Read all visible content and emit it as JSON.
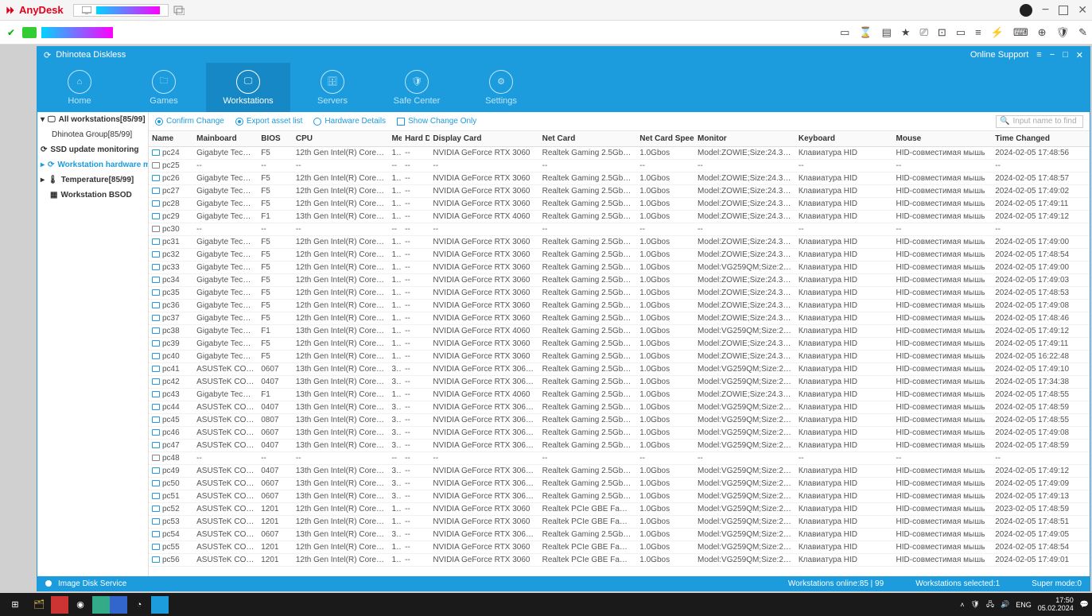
{
  "anydesk": {
    "name": "AnyDesk"
  },
  "app": {
    "title": "Dhinotea Diskless",
    "online_support": "Online Support",
    "nav": [
      "Home",
      "Games",
      "Workstations",
      "Servers",
      "Safe Center",
      "Settings"
    ],
    "nav_active": 2
  },
  "sidebar": {
    "all": "All workstations[85/99]",
    "group": "Dhinotea Group[85/99]",
    "ssd": "SSD update monitoring",
    "hwmon": "Workstation hardware mon",
    "temp": "Temperature[85/99]",
    "bsod": "Workstation BSOD"
  },
  "toolbar": {
    "confirm": "Confirm Change",
    "export": "Export asset list",
    "hw": "Hardware Details",
    "showonly": "Show Change Only",
    "search_ph": "Input name to find"
  },
  "headers": [
    "Name",
    "Mainboard",
    "BIOS",
    "CPU",
    "Me",
    "Hard D",
    "Display Card",
    "Net Card",
    "Net Card Speed",
    "Monitor",
    "Keyboard",
    "Mouse",
    "Time Changed"
  ],
  "rows": [
    {
      "on": 1,
      "name": "pc24",
      "mb": "Gigabyte Techno...",
      "bios": "F5",
      "cpu": "12th Gen Intel(R) Core(T...",
      "me": "1...",
      "hd": "--",
      "dc": "NVIDIA GeForce RTX 3060",
      "nc": "Realtek Gaming 2.5GbE Fa...",
      "ns": "1.0Gbos",
      "mon": "Model:ZOWIE;Size:24.3 inc...",
      "kb": "Клавиатура HID",
      "mouse": "HID-совместимая мышь",
      "time": "2024-02-05 17:48:56"
    },
    {
      "on": 0,
      "name": "pc25",
      "mb": "--",
      "bios": "--",
      "cpu": "--",
      "me": "--",
      "hd": "--",
      "dc": "--",
      "nc": "--",
      "ns": "--",
      "mon": "--",
      "kb": "--",
      "mouse": "--",
      "time": "--"
    },
    {
      "on": 1,
      "name": "pc26",
      "mb": "Gigabyte Techno...",
      "bios": "F5",
      "cpu": "12th Gen Intel(R) Core(T...",
      "me": "1...",
      "hd": "--",
      "dc": "NVIDIA GeForce RTX 3060",
      "nc": "Realtek Gaming 2.5GbE Fa...",
      "ns": "1.0Gbos",
      "mon": "Model:ZOWIE;Size:24.3 inc...",
      "kb": "Клавиатура HID",
      "mouse": "HID-совместимая мышь",
      "time": "2024-02-05 17:48:57"
    },
    {
      "on": 1,
      "name": "pc27",
      "mb": "Gigabyte Techno...",
      "bios": "F5",
      "cpu": "12th Gen Intel(R) Core(T...",
      "me": "1...",
      "hd": "--",
      "dc": "NVIDIA GeForce RTX 3060",
      "nc": "Realtek Gaming 2.5GbE Fa...",
      "ns": "1.0Gbos",
      "mon": "Model:ZOWIE;Size:24.3 inc...",
      "kb": "Клавиатура HID",
      "mouse": "HID-совместимая мышь",
      "time": "2024-02-05 17:49:02"
    },
    {
      "on": 1,
      "name": "pc28",
      "mb": "Gigabyte Techno...",
      "bios": "F5",
      "cpu": "12th Gen Intel(R) Core(T...",
      "me": "1...",
      "hd": "--",
      "dc": "NVIDIA GeForce RTX 3060",
      "nc": "Realtek Gaming 2.5GbE Fa...",
      "ns": "1.0Gbos",
      "mon": "Model:ZOWIE;Size:24.3 inc...",
      "kb": "Клавиатура HID",
      "mouse": "HID-совместимая мышь",
      "time": "2024-02-05 17:49:11"
    },
    {
      "on": 1,
      "name": "pc29",
      "mb": "Gigabyte Techno...",
      "bios": "F1",
      "cpu": "13th Gen Intel(R) Core(T...",
      "me": "1...",
      "hd": "--",
      "dc": "NVIDIA GeForce RTX 4060",
      "nc": "Realtek Gaming 2.5GbE Fa...",
      "ns": "1.0Gbos",
      "mon": "Model:ZOWIE;Size:24.3 inc...",
      "kb": "Клавиатура HID",
      "mouse": "HID-совместимая мышь",
      "time": "2024-02-05 17:49:12"
    },
    {
      "on": 0,
      "name": "pc30",
      "mb": "--",
      "bios": "--",
      "cpu": "--",
      "me": "--",
      "hd": "--",
      "dc": "--",
      "nc": "--",
      "ns": "--",
      "mon": "--",
      "kb": "--",
      "mouse": "--",
      "time": "--"
    },
    {
      "on": 1,
      "name": "pc31",
      "mb": "Gigabyte Techno...",
      "bios": "F5",
      "cpu": "12th Gen Intel(R) Core(T...",
      "me": "1...",
      "hd": "--",
      "dc": "NVIDIA GeForce RTX 3060",
      "nc": "Realtek Gaming 2.5GbE Fa...",
      "ns": "1.0Gbos",
      "mon": "Model:ZOWIE;Size:24.3 inc...",
      "kb": "Клавиатура HID",
      "mouse": "HID-совместимая мышь",
      "time": "2024-02-05 17:49:00"
    },
    {
      "on": 1,
      "name": "pc32",
      "mb": "Gigabyte Techno...",
      "bios": "F5",
      "cpu": "12th Gen Intel(R) Core(T...",
      "me": "1...",
      "hd": "--",
      "dc": "NVIDIA GeForce RTX 3060",
      "nc": "Realtek Gaming 2.5GbE Fa...",
      "ns": "1.0Gbos",
      "mon": "Model:ZOWIE;Size:24.3 inc...",
      "kb": "Клавиатура HID",
      "mouse": "HID-совместимая мышь",
      "time": "2024-02-05 17:48:54"
    },
    {
      "on": 1,
      "name": "pc33",
      "mb": "Gigabyte Techno...",
      "bios": "F5",
      "cpu": "12th Gen Intel(R) Core(T...",
      "me": "1...",
      "hd": "--",
      "dc": "NVIDIA GeForce RTX 3060",
      "nc": "Realtek Gaming 2.5GbE Fa...",
      "ns": "1.0Gbos",
      "mon": "Model:VG259QM;Size:24.3 ...",
      "kb": "Клавиатура HID",
      "mouse": "HID-совместимая мышь",
      "time": "2024-02-05 17:49:00"
    },
    {
      "on": 1,
      "name": "pc34",
      "mb": "Gigabyte Techno...",
      "bios": "F5",
      "cpu": "12th Gen Intel(R) Core(T...",
      "me": "1...",
      "hd": "--",
      "dc": "NVIDIA GeForce RTX 3060",
      "nc": "Realtek Gaming 2.5GbE Fa...",
      "ns": "1.0Gbos",
      "mon": "Model:ZOWIE;Size:24.3 inc...",
      "kb": "Клавиатура HID",
      "mouse": "HID-совместимая мышь",
      "time": "2024-02-05 17:49:03"
    },
    {
      "on": 1,
      "name": "pc35",
      "mb": "Gigabyte Techno...",
      "bios": "F5",
      "cpu": "12th Gen Intel(R) Core(T...",
      "me": "1...",
      "hd": "--",
      "dc": "NVIDIA GeForce RTX 3060",
      "nc": "Realtek Gaming 2.5GbE Fa...",
      "ns": "1.0Gbos",
      "mon": "Model:ZOWIE;Size:24.3 inc...",
      "kb": "Клавиатура HID",
      "mouse": "HID-совместимая мышь",
      "time": "2024-02-05 17:48:53"
    },
    {
      "on": 1,
      "name": "pc36",
      "mb": "Gigabyte Techno...",
      "bios": "F5",
      "cpu": "12th Gen Intel(R) Core(T...",
      "me": "1...",
      "hd": "--",
      "dc": "NVIDIA GeForce RTX 3060",
      "nc": "Realtek Gaming 2.5GbE Fa...",
      "ns": "1.0Gbos",
      "mon": "Model:ZOWIE;Size:24.3 inc...",
      "kb": "Клавиатура HID",
      "mouse": "HID-совместимая мышь",
      "time": "2024-02-05 17:49:08"
    },
    {
      "on": 1,
      "name": "pc37",
      "mb": "Gigabyte Techno...",
      "bios": "F5",
      "cpu": "12th Gen Intel(R) Core(T...",
      "me": "1...",
      "hd": "--",
      "dc": "NVIDIA GeForce RTX 3060",
      "nc": "Realtek Gaming 2.5GbE Fa...",
      "ns": "1.0Gbos",
      "mon": "Model:ZOWIE;Size:24.3 inc...",
      "kb": "Клавиатура HID",
      "mouse": "HID-совместимая мышь",
      "time": "2024-02-05 17:48:46"
    },
    {
      "on": 1,
      "name": "pc38",
      "mb": "Gigabyte Techno...",
      "bios": "F1",
      "cpu": "13th Gen Intel(R) Core(T...",
      "me": "1...",
      "hd": "--",
      "dc": "NVIDIA GeForce RTX 4060",
      "nc": "Realtek Gaming 2.5GbE Fa...",
      "ns": "1.0Gbos",
      "mon": "Model:VG259QM;Size:24.3 ...",
      "kb": "Клавиатура HID",
      "mouse": "HID-совместимая мышь",
      "time": "2024-02-05 17:49:12"
    },
    {
      "on": 1,
      "name": "pc39",
      "mb": "Gigabyte Techno...",
      "bios": "F5",
      "cpu": "12th Gen Intel(R) Core(T...",
      "me": "1...",
      "hd": "--",
      "dc": "NVIDIA GeForce RTX 3060",
      "nc": "Realtek Gaming 2.5GbE Fa...",
      "ns": "1.0Gbos",
      "mon": "Model:ZOWIE;Size:24.3 inc...",
      "kb": "Клавиатура HID",
      "mouse": "HID-совместимая мышь",
      "time": "2024-02-05 17:49:11"
    },
    {
      "on": 1,
      "name": "pc40",
      "mb": "Gigabyte Techno...",
      "bios": "F5",
      "cpu": "12th Gen Intel(R) Core(T...",
      "me": "1...",
      "hd": "--",
      "dc": "NVIDIA GeForce RTX 3060",
      "nc": "Realtek Gaming 2.5GbE Fa...",
      "ns": "1.0Gbos",
      "mon": "Model:ZOWIE;Size:24.3 inc...",
      "kb": "Клавиатура HID",
      "mouse": "HID-совместимая мышь",
      "time": "2024-02-05 16:22:48"
    },
    {
      "on": 1,
      "name": "pc41",
      "mb": "ASUSTeK COMP...",
      "bios": "0607",
      "cpu": "13th Gen Intel(R) Core(T...",
      "me": "3...",
      "hd": "--",
      "dc": "NVIDIA GeForce RTX 3060 Ti",
      "nc": "Realtek Gaming 2.5GbE Fa...",
      "ns": "1.0Gbos",
      "mon": "Model:VG259QM;Size:24.3 ...",
      "kb": "Клавиатура HID",
      "mouse": "HID-совместимая мышь",
      "time": "2024-02-05 17:49:10"
    },
    {
      "on": 1,
      "name": "pc42",
      "mb": "ASUSTeK COMP...",
      "bios": "0407",
      "cpu": "13th Gen Intel(R) Core(T...",
      "me": "3...",
      "hd": "--",
      "dc": "NVIDIA GeForce RTX 3060 Ti",
      "nc": "Realtek Gaming 2.5GbE Fa...",
      "ns": "1.0Gbos",
      "mon": "Model:VG259QM;Size:24.3 ...",
      "kb": "Клавиатура HID",
      "mouse": "HID-совместимая мышь",
      "time": "2024-02-05 17:34:38"
    },
    {
      "on": 1,
      "name": "pc43",
      "mb": "Gigabyte Techno...",
      "bios": "F1",
      "cpu": "13th Gen Intel(R) Core(T...",
      "me": "1...",
      "hd": "--",
      "dc": "NVIDIA GeForce RTX 4060",
      "nc": "Realtek Gaming 2.5GbE Fa...",
      "ns": "1.0Gbos",
      "mon": "Model:ZOWIE;Size:24.3 inc...",
      "kb": "Клавиатура HID",
      "mouse": "HID-совместимая мышь",
      "time": "2024-02-05 17:48:55"
    },
    {
      "on": 1,
      "name": "pc44",
      "mb": "ASUSTeK COMP...",
      "bios": "0407",
      "cpu": "13th Gen Intel(R) Core(T...",
      "me": "3...",
      "hd": "--",
      "dc": "NVIDIA GeForce RTX 3060 Ti",
      "nc": "Realtek Gaming 2.5GbE Fa...",
      "ns": "1.0Gbos",
      "mon": "Model:VG259QM;Size:24.3 ...",
      "kb": "Клавиатура HID",
      "mouse": "HID-совместимая мышь",
      "time": "2024-02-05 17:48:59"
    },
    {
      "on": 1,
      "name": "pc45",
      "mb": "ASUSTeK COMP...",
      "bios": "0807",
      "cpu": "13th Gen Intel(R) Core(T...",
      "me": "3...",
      "hd": "--",
      "dc": "NVIDIA GeForce RTX 3060 Ti",
      "nc": "Realtek Gaming 2.5GbE Fa...",
      "ns": "1.0Gbos",
      "mon": "Model:VG259QM;Size:24.3 ...",
      "kb": "Клавиатура HID",
      "mouse": "HID-совместимая мышь",
      "time": "2024-02-05 17:48:55"
    },
    {
      "on": 1,
      "name": "pc46",
      "mb": "ASUSTeK COMP...",
      "bios": "0607",
      "cpu": "13th Gen Intel(R) Core(T...",
      "me": "3...",
      "hd": "--",
      "dc": "NVIDIA GeForce RTX 3060 Ti",
      "nc": "Realtek Gaming 2.5GbE Fa...",
      "ns": "1.0Gbos",
      "mon": "Model:VG259QM;Size:24.3 ...",
      "kb": "Клавиатура HID",
      "mouse": "HID-совместимая мышь",
      "time": "2024-02-05 17:49:08"
    },
    {
      "on": 1,
      "name": "pc47",
      "mb": "ASUSTeK COMP...",
      "bios": "0407",
      "cpu": "13th Gen Intel(R) Core(T...",
      "me": "3...",
      "hd": "--",
      "dc": "NVIDIA GeForce RTX 3060 Ti",
      "nc": "Realtek Gaming 2.5GbE Fa...",
      "ns": "1.0Gbos",
      "mon": "Model:VG259QM;Size:24.3 ...",
      "kb": "Клавиатура HID",
      "mouse": "HID-совместимая мышь",
      "time": "2024-02-05 17:48:59"
    },
    {
      "on": 0,
      "name": "pc48",
      "mb": "--",
      "bios": "--",
      "cpu": "--",
      "me": "--",
      "hd": "--",
      "dc": "--",
      "nc": "--",
      "ns": "--",
      "mon": "--",
      "kb": "--",
      "mouse": "--",
      "time": "--"
    },
    {
      "on": 1,
      "name": "pc49",
      "mb": "ASUSTeK COMP...",
      "bios": "0407",
      "cpu": "13th Gen Intel(R) Core(T...",
      "me": "3...",
      "hd": "--",
      "dc": "NVIDIA GeForce RTX 3060 Ti",
      "nc": "Realtek Gaming 2.5GbE Fa...",
      "ns": "1.0Gbos",
      "mon": "Model:VG259QM;Size:24.3 ...",
      "kb": "Клавиатура HID",
      "mouse": "HID-совместимая мышь",
      "time": "2024-02-05 17:49:12"
    },
    {
      "on": 1,
      "name": "pc50",
      "mb": "ASUSTeK COMP...",
      "bios": "0607",
      "cpu": "13th Gen Intel(R) Core(T...",
      "me": "3...",
      "hd": "--",
      "dc": "NVIDIA GeForce RTX 3060 Ti",
      "nc": "Realtek Gaming 2.5GbE Fa...",
      "ns": "1.0Gbos",
      "mon": "Model:VG259QM;Size:24.3 ...",
      "kb": "Клавиатура HID",
      "mouse": "HID-совместимая мышь",
      "time": "2024-02-05 17:49:09"
    },
    {
      "on": 1,
      "name": "pc51",
      "mb": "ASUSTeK COMP...",
      "bios": "0607",
      "cpu": "13th Gen Intel(R) Core(T...",
      "me": "3...",
      "hd": "--",
      "dc": "NVIDIA GeForce RTX 3060 Ti",
      "nc": "Realtek Gaming 2.5GbE Fa...",
      "ns": "1.0Gbos",
      "mon": "Model:VG259QM;Size:24.3 ...",
      "kb": "Клавиатура HID",
      "mouse": "HID-совместимая мышь",
      "time": "2024-02-05 17:49:13"
    },
    {
      "on": 1,
      "name": "pc52",
      "mb": "ASUSTeK COMP...",
      "bios": "1201",
      "cpu": "12th Gen Intel(R) Core(T...",
      "me": "1...",
      "hd": "--",
      "dc": "NVIDIA GeForce RTX 3060",
      "nc": "Realtek PCIe GBE Family C...",
      "ns": "1.0Gbos",
      "mon": "Model:VG259QM;Size:21.3 ...",
      "kb": "Клавиатура HID",
      "mouse": "HID-совместимая мышь",
      "time": "2023-02-05 17:48:59"
    },
    {
      "on": 1,
      "name": "pc53",
      "mb": "ASUSTeK COMP...",
      "bios": "1201",
      "cpu": "12th Gen Intel(R) Core(T...",
      "me": "1...",
      "hd": "--",
      "dc": "NVIDIA GeForce RTX 3060",
      "nc": "Realtek PCIe GBE Family C...",
      "ns": "1.0Gbos",
      "mon": "Model:VG259QM;Size:24.3 ...",
      "kb": "Клавиатура HID",
      "mouse": "HID-совместимая мышь",
      "time": "2024-02-05 17:48:51"
    },
    {
      "on": 1,
      "name": "pc54",
      "mb": "ASUSTeK COMP...",
      "bios": "0607",
      "cpu": "13th Gen Intel(R) Core(T...",
      "me": "3...",
      "hd": "--",
      "dc": "NVIDIA GeForce RTX 3060 Ti",
      "nc": "Realtek Gaming 2.5GbE Fa...",
      "ns": "1.0Gbos",
      "mon": "Model:VG259QM;Size:24.3 ...",
      "kb": "Клавиатура HID",
      "mouse": "HID-совместимая мышь",
      "time": "2024-02-05 17:49:05"
    },
    {
      "on": 1,
      "name": "pc55",
      "mb": "ASUSTeK COMP...",
      "bios": "1201",
      "cpu": "12th Gen Intel(R) Core(T...",
      "me": "1...",
      "hd": "--",
      "dc": "NVIDIA GeForce RTX 3060",
      "nc": "Realtek PCIe GBE Family C...",
      "ns": "1.0Gbos",
      "mon": "Model:VG259QM;Size:24.3 ...",
      "kb": "Клавиатура HID",
      "mouse": "HID-совместимая мышь",
      "time": "2024-02-05 17:48:54"
    },
    {
      "on": 1,
      "name": "pc56",
      "mb": "ASUSTeK COMP...",
      "bios": "1201",
      "cpu": "12th Gen Intel(R) Core(T...",
      "me": "1...",
      "hd": "--",
      "dc": "NVIDIA GeForce RTX 3060",
      "nc": "Realtek PCIe GBE Family C...",
      "ns": "1.0Gbos",
      "mon": "Model:VG259QM;Size:21.3 ...",
      "kb": "Клавиатура HID",
      "mouse": "HID-совместимая мышь",
      "time": "2024-02-05 17:49:01"
    }
  ],
  "status": {
    "service": "Image Disk Service",
    "online": "Workstations online:85 | 99",
    "selected": "Workstations selected:1",
    "supermode": "Super mode:0"
  },
  "taskbar": {
    "lang": "ENG",
    "time": "17:50",
    "date": "05.02.2024"
  }
}
